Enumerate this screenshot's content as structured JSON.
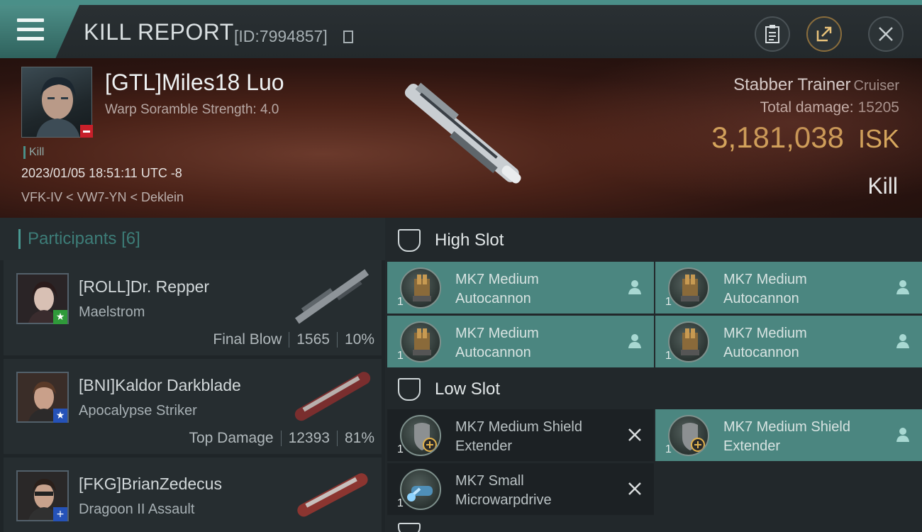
{
  "header": {
    "title": "KILL REPORT",
    "id_label": "[ID:7994857]",
    "icons": [
      "menu-icon",
      "copy-icon",
      "clipboard-icon",
      "share-icon",
      "close-icon"
    ]
  },
  "victim": {
    "name": "[GTL]Miles18 Luo",
    "warp": "Warp Soramble Strength: 4.0",
    "tag": "Kill",
    "datetime": "2023/01/05 18:51:11 UTC -8",
    "location": "VFK-IV < VW7-YN < Deklein",
    "ship": "Stabber Trainer",
    "ship_class": "Cruiser",
    "total_damage_label": "Total damage:",
    "total_damage": "15205",
    "isk_value": "3,181,038",
    "isk_unit": "ISK",
    "result": "Kill"
  },
  "participants": {
    "title": "Participants",
    "count": "[6]",
    "rows": [
      {
        "name": "[ROLL]Dr. Repper",
        "ship": "Maelstrom",
        "role": "Final Blow",
        "damage": "1565",
        "percent": "10%",
        "badge": "star",
        "badge_color": "#2f9a3a"
      },
      {
        "name": "[BNI]Kaldor Darkblade",
        "ship": "Apocalypse Striker",
        "role": "Top Damage",
        "damage": "12393",
        "percent": "81%",
        "badge": "star",
        "badge_color": "#2552b8"
      },
      {
        "name": "[FKG]BrianZedecus",
        "ship": "Dragoon II Assault",
        "badge": "plus",
        "badge_color": "#2552b8"
      }
    ]
  },
  "slots": {
    "high": {
      "title": "High Slot",
      "modules": [
        {
          "qty": "1",
          "name1": "MK7 Medium",
          "name2": "Autocannon",
          "state": "person-icon"
        },
        {
          "qty": "1",
          "name1": "MK7 Medium",
          "name2": "Autocannon",
          "state": "person-icon"
        },
        {
          "qty": "1",
          "name1": "MK7 Medium",
          "name2": "Autocannon",
          "state": "person-icon"
        },
        {
          "qty": "1",
          "name1": "MK7 Medium",
          "name2": "Autocannon",
          "state": "person-icon"
        }
      ]
    },
    "low": {
      "title": "Low Slot",
      "modules": [
        {
          "qty": "1",
          "name1": "MK7 Medium Shield",
          "name2": "Extender",
          "state": "x-icon"
        },
        {
          "qty": "1",
          "name1": "MK7 Medium Shield",
          "name2": "Extender",
          "state": "person-icon"
        },
        {
          "qty": "1",
          "name1": "MK7 Small",
          "name2": "Microwarpdrive",
          "state": "x-icon"
        }
      ]
    }
  },
  "colors": {
    "accent": "#4a8f88",
    "isk": "#f3c76a",
    "module_teal": "#4b8680"
  }
}
